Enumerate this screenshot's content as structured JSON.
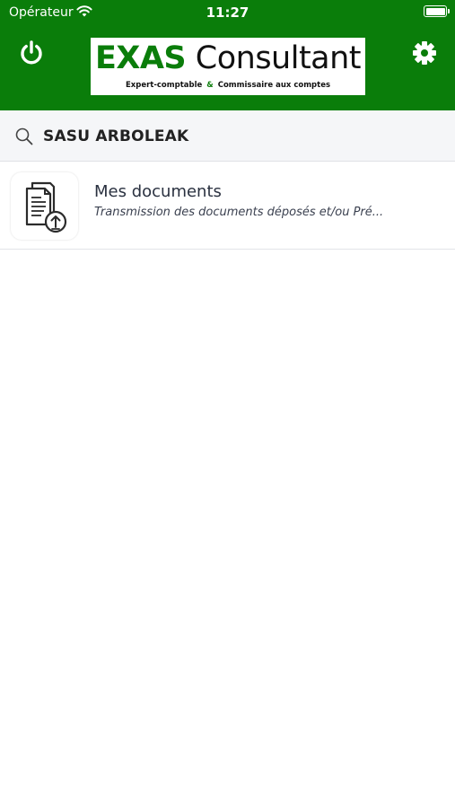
{
  "status_bar": {
    "carrier": "Opérateur",
    "time": "11:27"
  },
  "header": {
    "logo_brand": "EXAS",
    "logo_name": "Consultant",
    "logo_sub_left": "Expert-comptable",
    "logo_sub_amp": "&",
    "logo_sub_right": "Commissaire aux comptes",
    "brand_color": "#0a7d0a",
    "left_icon": "power-icon",
    "right_icon": "gear-icon"
  },
  "search": {
    "icon": "search-icon",
    "value": "SASU ARBOLEAK"
  },
  "list": {
    "items": [
      {
        "icon": "document-upload-icon",
        "title": "Mes documents",
        "subtitle": "Transmission des documents déposés et/ou Pré..."
      }
    ]
  }
}
